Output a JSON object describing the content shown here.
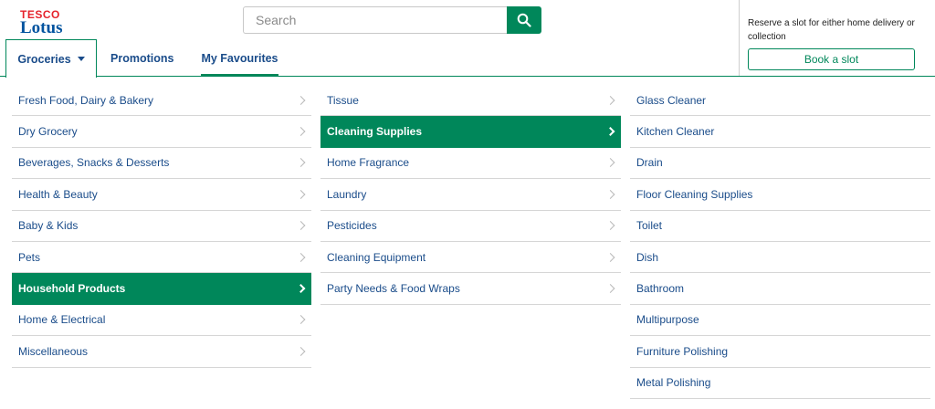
{
  "logo": {
    "top": "TESCO",
    "bottom": "Lotus"
  },
  "search": {
    "placeholder": "Search",
    "icon": "search-icon"
  },
  "tabs": [
    {
      "label": "Groceries",
      "icon": "caret-down-icon"
    },
    {
      "label": "Promotions"
    },
    {
      "label": "My Favourites"
    }
  ],
  "slot": {
    "text": "Reserve a slot for either home delivery or collection",
    "button": "Book a slot"
  },
  "menu": {
    "categories": [
      "Fresh Food, Dairy & Bakery",
      "Dry Grocery",
      "Beverages, Snacks & Desserts",
      "Health & Beauty",
      "Baby & Kids",
      "Pets",
      "Household Products",
      "Home & Electrical",
      "Miscellaneous"
    ],
    "active_category": "Household Products",
    "subcategories": [
      "Tissue",
      "Cleaning Supplies",
      "Home Fragrance",
      "Laundry",
      "Pesticides",
      "Cleaning Equipment",
      "Party Needs & Food Wraps"
    ],
    "active_subcategory": "Cleaning Supplies",
    "items": [
      "Glass Cleaner",
      "Kitchen Cleaner",
      "Drain",
      "Floor Cleaning Supplies",
      "Toilet",
      "Dish",
      "Bathroom",
      "Multipurpose",
      "Furniture Polishing",
      "Metal Polishing"
    ]
  },
  "colors": {
    "brand_green": "#00875a",
    "link_blue": "#1a4c8a",
    "logo_red": "#e5232c",
    "logo_blue": "#00539f"
  }
}
